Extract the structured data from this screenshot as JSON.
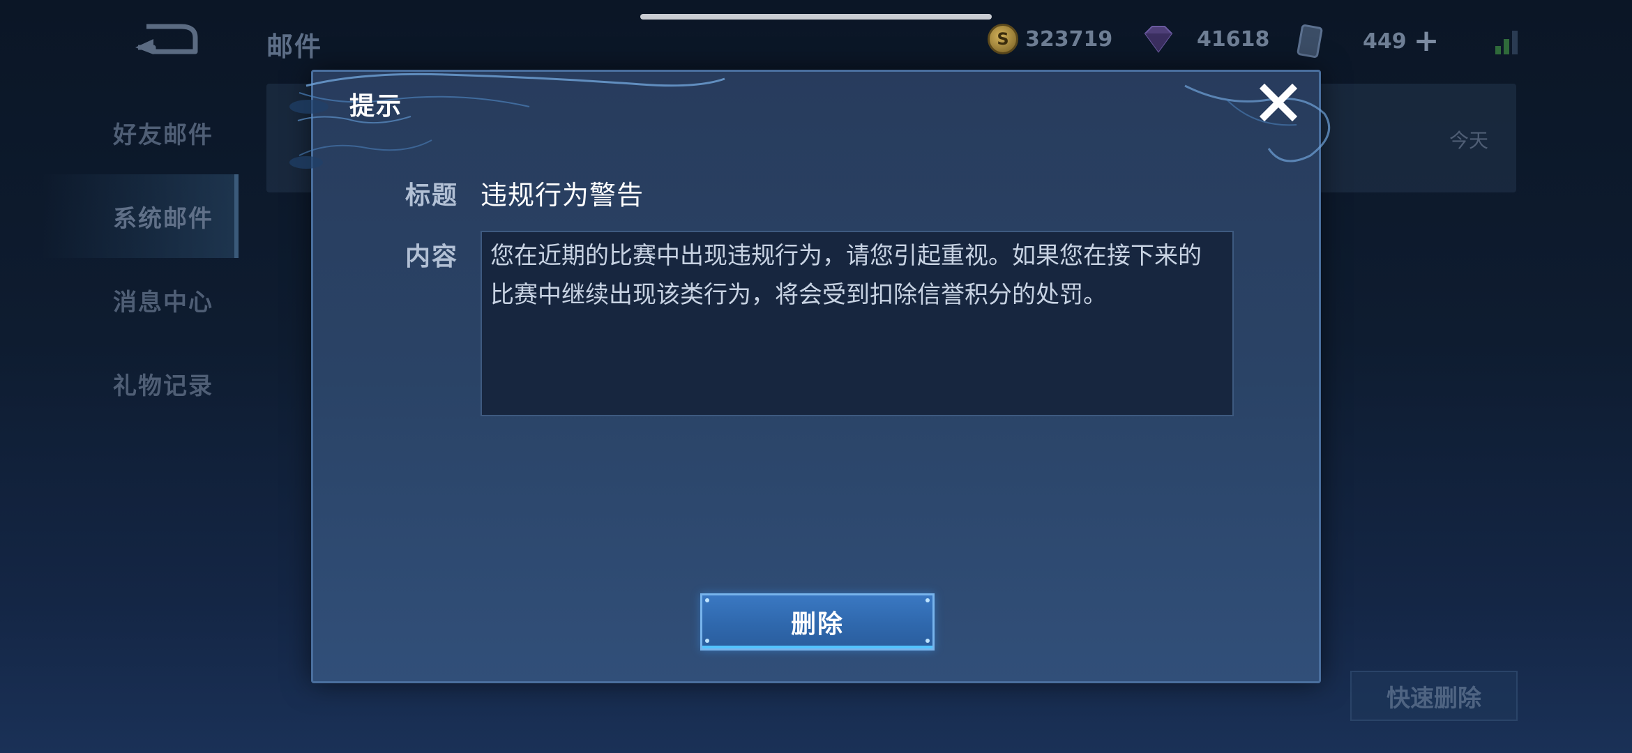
{
  "background": {
    "page_title": "邮件",
    "currencies": {
      "gold": "323719",
      "diamond": "41618",
      "voucher": "449"
    },
    "side_nav": [
      {
        "label": "好友邮件",
        "active": false
      },
      {
        "label": "系统邮件",
        "active": true
      },
      {
        "label": "消息中心",
        "active": false
      },
      {
        "label": "礼物记录",
        "active": false
      }
    ],
    "mail_item_date": "今天",
    "quick_delete_label": "快速删除"
  },
  "dialog": {
    "title": "提示",
    "subject_label": "标题",
    "subject_value": "违规行为警告",
    "content_label": "内容",
    "content_text": "您在近期的比赛中出现违规行为，请您引起重视。如果您在接下来的比赛中继续出现该类行为，将会受到扣除信誉积分的处罚。",
    "delete_label": "删除"
  },
  "colors": {
    "dialog_bg": "#2a4366",
    "dialog_border": "#4a6f9e",
    "button_blue": "#3a78c2",
    "button_glow": "#53c4ff",
    "label_text": "#b2c0d5"
  },
  "icons": {
    "back": "back-arrow-icon",
    "gold": "gold-coin-icon",
    "diamond": "diamond-gem-icon",
    "voucher": "voucher-card-icon",
    "add": "plus-icon",
    "signal": "signal-bars-icon",
    "close": "close-x-icon"
  }
}
